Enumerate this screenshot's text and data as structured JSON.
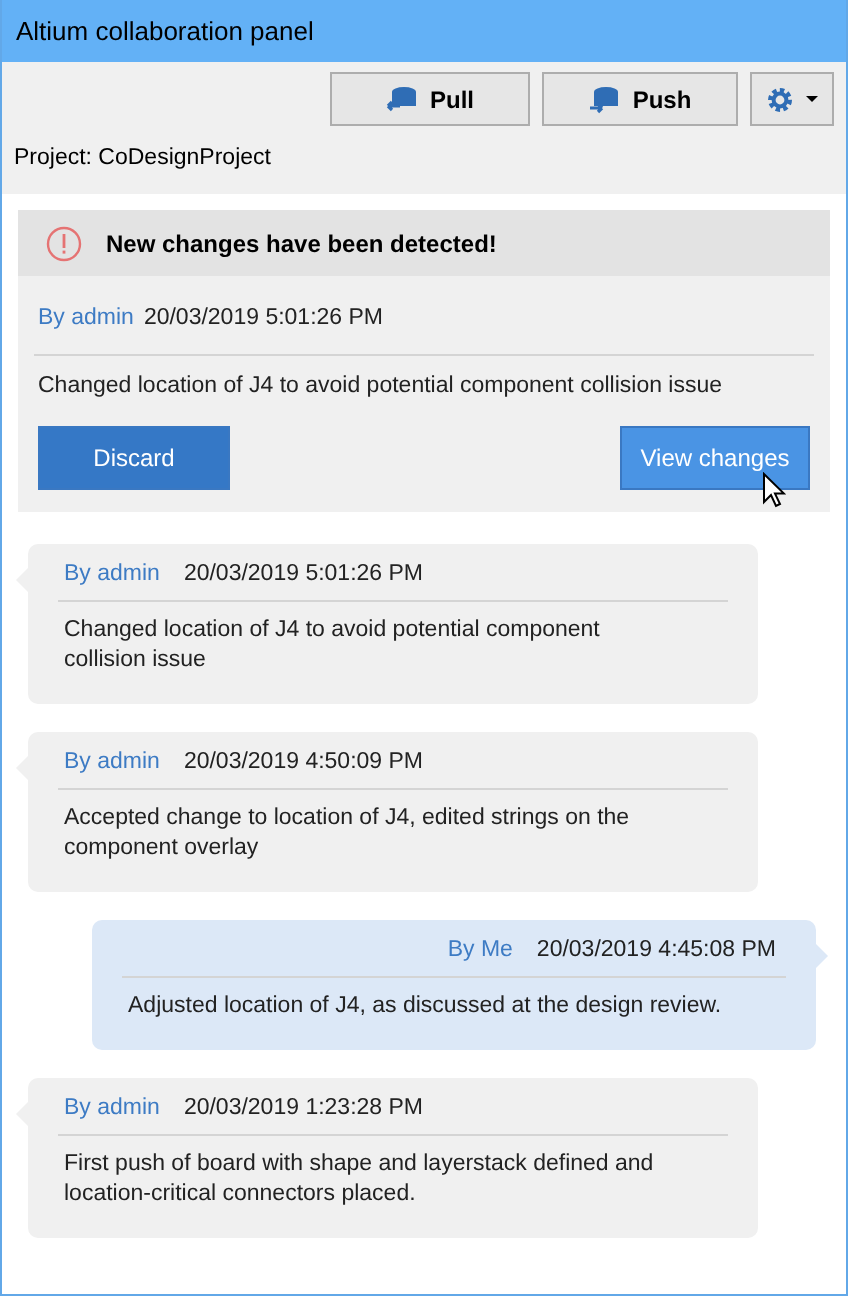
{
  "window": {
    "title": "Altium collaboration panel"
  },
  "toolbar": {
    "buttons": [
      {
        "kind": "pull",
        "label": "Pull"
      },
      {
        "kind": "push",
        "label": "Push"
      },
      {
        "kind": "settings"
      }
    ]
  },
  "project": "Project: CoDesignProject",
  "alert": {
    "title": "New changes have been detected!",
    "author": "By admin",
    "time": "20/03/2019 5:01:26 PM",
    "message": "Changed location of J4 to avoid potential component collision issue",
    "buttons": [
      {
        "kind": "secondary",
        "label": "Discard",
        "hovered": false
      },
      {
        "kind": "primary",
        "label": "View changes",
        "hovered": true
      }
    ]
  },
  "messages": [
    {
      "kind": "received",
      "author": "By admin",
      "time": "20/03/2019 5:01:26 PM",
      "text": "Changed location of J4 to avoid potential component collision issue"
    },
    {
      "kind": "received",
      "author": "By admin",
      "time": "20/03/2019 4:50:09 PM",
      "text": "Accepted change to location of J4, edited strings on the component overlay"
    },
    {
      "kind": "sent",
      "author": "By Me",
      "time": "20/03/2019 4:45:08 PM",
      "text": "Adjusted location of J4, as discussed at the design review."
    },
    {
      "kind": "received",
      "author": "By admin",
      "time": "20/03/2019 1:23:28 PM",
      "text": "First push of board with shape and layerstack defined and location-critical connectors placed."
    }
  ]
}
